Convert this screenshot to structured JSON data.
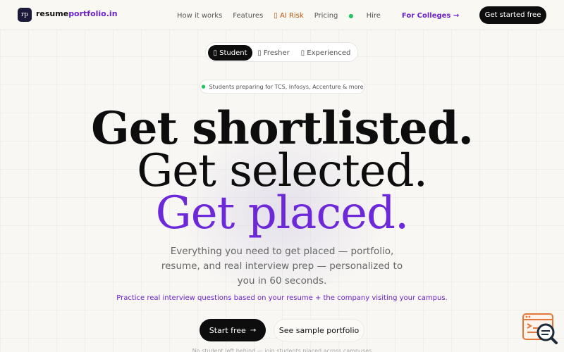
{
  "nav": {
    "logo_text": "rp",
    "brand_main": "resume",
    "brand_accent": "portfolio.in",
    "links": {
      "how_it_works": "How it works",
      "features": "Features",
      "ai_risk": "▯ AI Risk",
      "pricing": "Pricing",
      "hire": "Hire",
      "for_colleges": "For Colleges →"
    },
    "cta": "Get started free"
  },
  "segments": {
    "student": "▯ Student",
    "fresher": "▯ Fresher",
    "experienced": "▯ Experienced",
    "selected": "student"
  },
  "badge": "Students preparing for TCS, Infosys, Accenture & more",
  "headline": {
    "line1": "Get shortlisted.",
    "line2": "Get selected.",
    "line3": "Get placed."
  },
  "subtext": "Everything you need to get placed — portfolio, resume, and real interview prep — personalized to you in 60 seconds.",
  "practice": "Practice real interview questions based on your resume + the company visiting your campus.",
  "buttons": {
    "start": "Start free",
    "sample": "See sample portfolio"
  },
  "footnote": "No student left behind — join students placed across campuses",
  "colors": {
    "accent": "#6d28d9",
    "primary_button": "#0d0d0d",
    "ai_risk": "#b45309",
    "live_dot": "#22c55e",
    "widget": "#e5773b"
  },
  "icons": {
    "ai_risk": "shield-icon",
    "segments": [
      "graduation-cap-icon",
      "briefcase-icon",
      "trophy-icon"
    ],
    "arrow": "arrow-right-icon",
    "widget": "code-search-icon"
  }
}
